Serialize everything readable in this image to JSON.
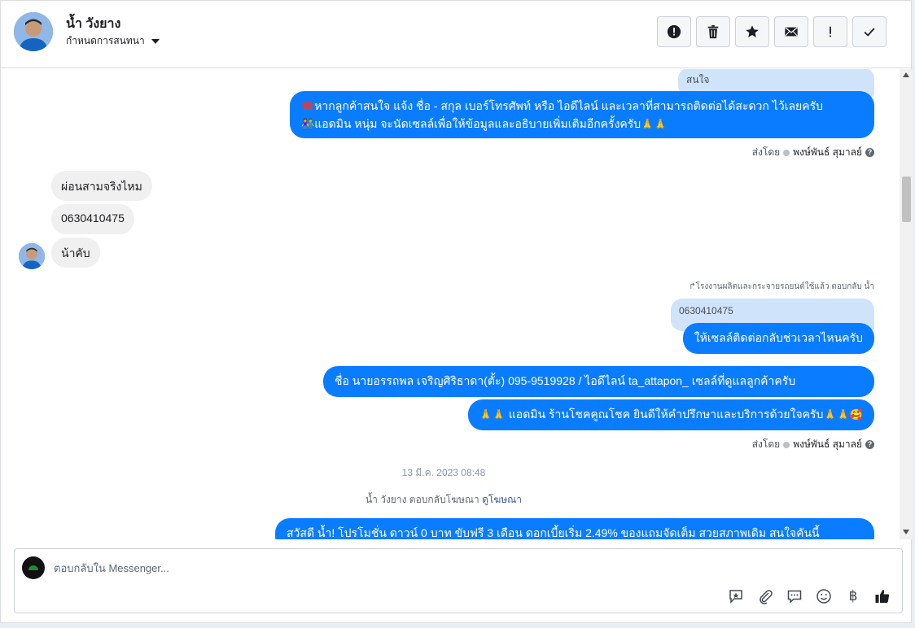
{
  "header": {
    "contact_name": "น้ำ วังยาง",
    "subtitle": "กำหนดการสนทนา",
    "actions": [
      {
        "name": "spam-button",
        "icon": "alert-circle-icon"
      },
      {
        "name": "delete-button",
        "icon": "trash-icon"
      },
      {
        "name": "star-button",
        "icon": "star-icon"
      },
      {
        "name": "mark-unread-button",
        "icon": "envelope-icon"
      },
      {
        "name": "important-button",
        "icon": "exclamation-icon"
      },
      {
        "name": "done-button",
        "icon": "check-icon"
      }
    ]
  },
  "conversation": {
    "quote_top": "สนใจ",
    "msg_out_1_line1": "หากลูกค้าสนใจ แจ้ง ชื่อ - สกุล เบอร์โทรศัพท์ หรือ ไอดีไลน์ และเวลาที่สามารถติดต่อได้สะดวก ไว้เลยครับ",
    "msg_out_1_line2": "แอดมิน หนุ่ม จะนัดเซลล์เพื่อให้ข้อมูลและอธิบายเพิ่มเติมอีกครั้งครับ",
    "emoji_phone": "☎",
    "emoji_people": "👫",
    "emoji_pray": "🙏🙏",
    "sent_by_label": "ส่งโดย",
    "sender_name": "พงษ์พันธ์ สุมาลย์",
    "help_mark": "?",
    "msg_in_1": "ผ่อนสามจริงไหม",
    "msg_in_2": "0630410475",
    "msg_in_3": "น้าคับ",
    "reply_note": "↱โรงงานผลิตและกระจายรถยนต์ใช้แล้ว ตอบกลับ น้ำ",
    "quote_phone": "0630410475",
    "msg_out_2": "ให้เซลล์ติดต่อกลับช่วเวลาไหนครับ",
    "msg_out_3": "ชื่อ นายอรรถพล เจริญศิริธาดา(ตั้ะ)        095-9519928 / ไอดีไลน์ ta_attapon_  เซลล์ที่ดูแลลูกค้าครับ",
    "msg_out_4": "แอดมิน ร้านโชคคูณโชค ยินดีให้คำปรึกษาและบริการด้วยใจครับ",
    "emoji_smile": "🥰",
    "timestamp": "13 มี.ค. 2023 08:48",
    "ad_reply_text": "น้ำ วังยาง ตอบกลับโฆษณา",
    "ad_reply_link": "ดูโฆษณา",
    "msg_out_5_partial": "สวัสดี น้ำ! โปรโมชั่น ดาวน์ 0 บาท ขับฟรี 3 เดือน ดอกเบี้ยเริ่ม 2.49% ของแถมจัดเต็ม สวยสภาพเดิม สนใจคันนี้"
  },
  "composer": {
    "placeholder": "ตอบกลับใน Messenger...",
    "tools": [
      "saved-reply-icon",
      "attachment-icon",
      "chat-bubble-icon",
      "emoji-icon",
      "baht-icon",
      "thumbs-up-icon"
    ],
    "baht_symbol": "฿"
  },
  "colors": {
    "outgoing_bubble": "#0a7cff",
    "incoming_bubble": "#f0f0f0",
    "quote_bubble": "#cfe3fb"
  }
}
